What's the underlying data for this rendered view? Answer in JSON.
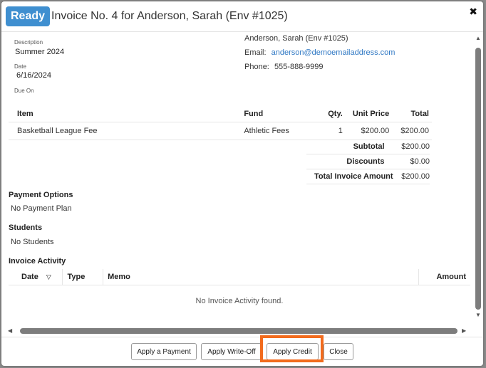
{
  "header": {
    "status_badge": "Ready",
    "title": "Invoice No. 4 for Anderson, Sarah (Env #1025)",
    "close_glyph": "✖"
  },
  "details": {
    "description_label": "Description",
    "description_value": "Summer 2024",
    "date_label": "Date",
    "date_value": "6/16/2024",
    "due_label": "Due On"
  },
  "contact": {
    "name": "Anderson, Sarah (Env #1025)",
    "email_label": "Email:",
    "email": "anderson@demoemailaddress.com",
    "phone_label": "Phone:",
    "phone": "555-888-9999"
  },
  "items": {
    "headers": {
      "item": "Item",
      "fund": "Fund",
      "qty": "Qty.",
      "unit_price": "Unit Price",
      "total": "Total"
    },
    "rows": [
      {
        "item": "Basketball League Fee",
        "fund": "Athletic Fees",
        "qty": "1",
        "unit_price": "$200.00",
        "total": "$200.00"
      }
    ]
  },
  "totals": {
    "subtotal_label": "Subtotal",
    "subtotal": "$200.00",
    "discounts_label": "Discounts",
    "discounts": "$0.00",
    "total_label": "Total Invoice Amount",
    "total": "$200.00"
  },
  "payment_options": {
    "title": "Payment Options",
    "value": "No Payment Plan"
  },
  "students": {
    "title": "Students",
    "value": "No Students"
  },
  "activity": {
    "title": "Invoice Activity",
    "headers": {
      "date": "Date",
      "sort_glyph": "▽",
      "type": "Type",
      "memo": "Memo",
      "amount": "Amount"
    },
    "empty_message": "No Invoice Activity found."
  },
  "scroll": {
    "up": "▲",
    "down": "▼",
    "left": "◀",
    "right": "▶"
  },
  "footer": {
    "apply_payment": "Apply a Payment",
    "apply_writeoff": "Apply Write-Off",
    "apply_credit": "Apply Credit",
    "close": "Close"
  },
  "colors": {
    "badge": "#3f8fd0",
    "link": "#2f78c4",
    "highlight": "#f26b1d"
  }
}
